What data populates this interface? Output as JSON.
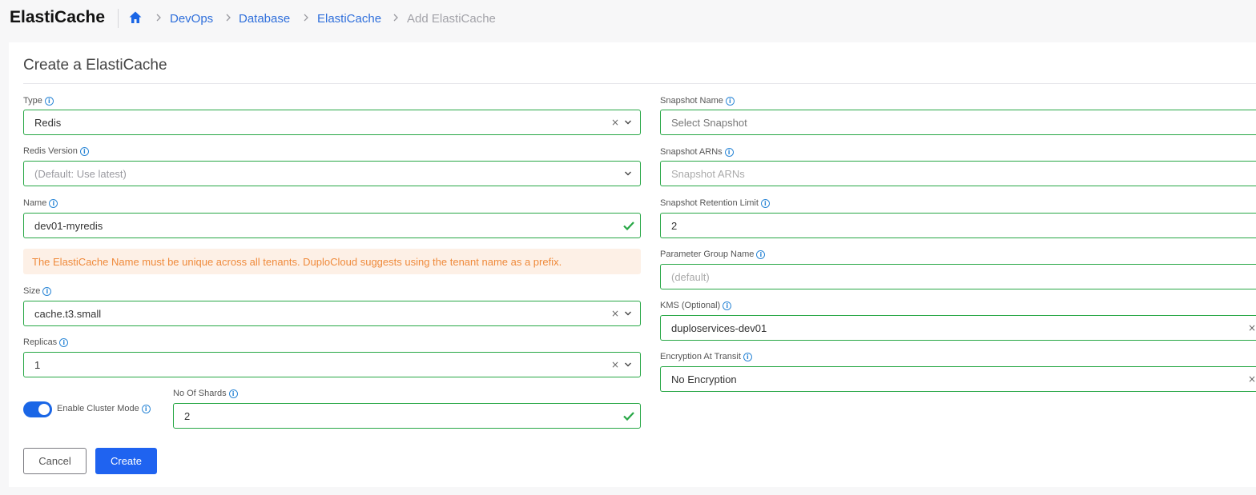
{
  "header": {
    "app_title": "ElastiCache",
    "breadcrumbs": [
      {
        "label": "DevOps"
      },
      {
        "label": "Database"
      },
      {
        "label": "ElastiCache"
      },
      {
        "label": "Add ElastiCache"
      }
    ]
  },
  "form": {
    "title": "Create a ElastiCache",
    "type": {
      "label": "Type",
      "value": "Redis"
    },
    "redis_version": {
      "label": "Redis Version",
      "placeholder": "(Default: Use latest)"
    },
    "name": {
      "label": "Name",
      "value": "dev01-myredis"
    },
    "name_warning": "The ElastiCache Name must be unique across all tenants. DuploCloud suggests using the tenant name as a prefix.",
    "size": {
      "label": "Size",
      "value": "cache.t3.small"
    },
    "replicas": {
      "label": "Replicas",
      "value": "1"
    },
    "cluster_mode": {
      "label": "Enable Cluster Mode",
      "enabled": true
    },
    "shards": {
      "label": "No Of Shards",
      "value": "2"
    },
    "snapshot_name": {
      "label": "Snapshot Name",
      "placeholder": "Select Snapshot"
    },
    "snapshot_arns": {
      "label": "Snapshot ARNs",
      "placeholder": "Snapshot ARNs"
    },
    "snapshot_retention": {
      "label": "Snapshot Retention Limit",
      "value": "2"
    },
    "parameter_group": {
      "label": "Parameter Group Name",
      "placeholder": "(default)"
    },
    "kms": {
      "label": "KMS (Optional)",
      "value": "duploservices-dev01"
    },
    "encryption_transit": {
      "label": "Encryption At Transit",
      "value": "No Encryption"
    },
    "cancel_label": "Cancel",
    "create_label": "Create"
  },
  "colors": {
    "accent": "#1f63f0",
    "valid_border": "#27a745",
    "warning_text": "#ef8a3b",
    "warning_bg": "#fdf0e6",
    "breadcrumb_link": "#2f6fdb"
  },
  "icons": {
    "home": "home-icon",
    "info": "info-icon",
    "clear": "clear-icon",
    "dropdown": "chevron-down-icon",
    "valid": "check-icon",
    "breadcrumb_sep": "chevron-right-icon"
  }
}
